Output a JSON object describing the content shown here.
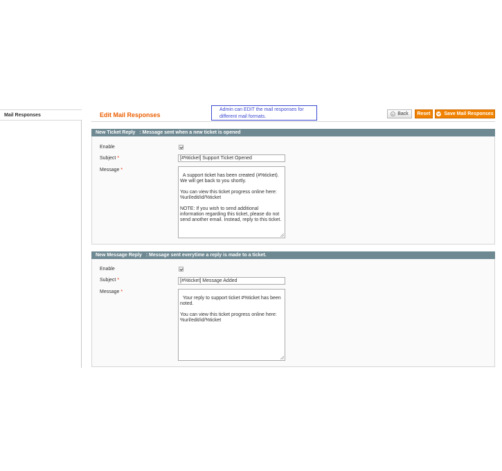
{
  "sidebar": {
    "title": "Mail Responses"
  },
  "header": {
    "page_title": "Edit Mail Responses",
    "annotation": [
      "Admin can EDIT the mail responses for",
      "different mail formats."
    ],
    "buttons": {
      "back": "Back",
      "reset": "Reset",
      "save": "Save Mail Responses"
    }
  },
  "sections": [
    {
      "title": "New Ticket Reply   : Message sent when a new ticket is opened",
      "enable_label": "Enable",
      "subject_label": "Subject",
      "subject_value": "[#%ticket] Support Ticket Opened",
      "message_label": "Message",
      "message_value": "A support ticket has been created (#%ticket). We will get back to you shortly.\n\nYou can view this ticket progress online here: %url/edit/id/%ticket\n\nNOTE: If you wish to send additional information regarding this ticket, please do not send another email. Instead, reply to this ticket."
    },
    {
      "title": "New Message Reply   : Message sent everytime a reply is made to a ticket.",
      "enable_label": "Enable",
      "subject_label": "Subject",
      "subject_value": "[#%ticket] Message Added",
      "message_label": "Message",
      "message_value": "Your reply to support ticket #%ticket has been noted.\n\nYou can view this ticket progress online here: %url/edit/id/%ticket"
    }
  ],
  "required_marker": "*",
  "colors": {
    "accent": "#eb5e00",
    "button": "#f18200",
    "section_header": "#6f8992",
    "annotation": "#3a47d2"
  }
}
